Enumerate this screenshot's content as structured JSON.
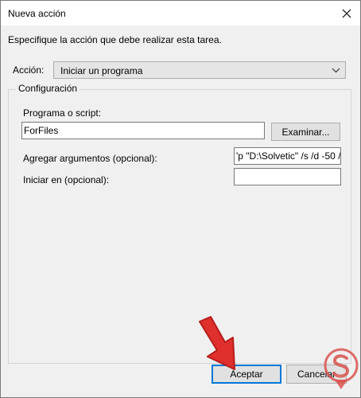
{
  "window": {
    "title": "Nueva acción"
  },
  "instructions": "Especifique la acción que debe realizar esta tarea.",
  "action": {
    "label": "Acción:",
    "selected": "Iniciar un programa"
  },
  "config": {
    "title": "Configuración",
    "program_label": "Programa o script:",
    "program_value": "ForFiles",
    "browse_label": "Examinar...",
    "args_label": "Agregar argumentos (opcional):",
    "args_value": "'p \"D:\\Solvetic\" /s /d -50 /",
    "start_label": "Iniciar en (opcional):",
    "start_value": ""
  },
  "buttons": {
    "ok": "Aceptar",
    "cancel": "Cancelar"
  },
  "colors": {
    "accent": "#0078d7",
    "arrow": "#e0302e",
    "logo": "#d9534f"
  },
  "icons": {
    "close": "close-icon",
    "dropdown": "chevron-down-icon",
    "annotation": "red-arrow-icon",
    "watermark": "solvetic-logo-icon"
  }
}
